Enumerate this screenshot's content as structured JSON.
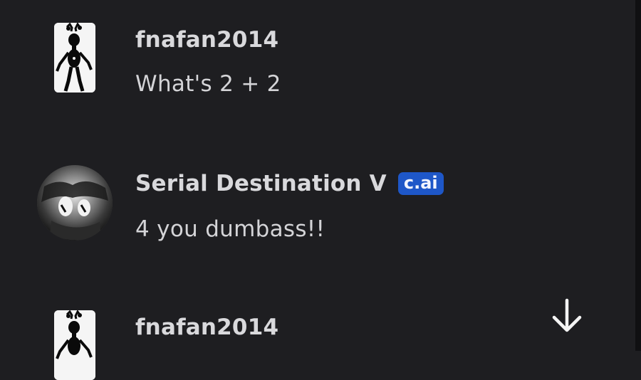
{
  "messages": [
    {
      "author": "fnafan2014",
      "text": "What's 2 + 2",
      "avatar_icon": "animatronic-avatar-icon"
    },
    {
      "author": "Serial Destination V",
      "badge": "c.ai",
      "text": "4 you dumbass!!",
      "avatar_icon": "character-avatar-icon"
    },
    {
      "author": "fnafan2014",
      "text": "",
      "avatar_icon": "animatronic-avatar-icon"
    }
  ],
  "scroll_button": {
    "icon": "arrow-down-icon"
  },
  "colors": {
    "background": "#1e1e21",
    "badge": "#1e57c8",
    "author_text": "#d9d9dc",
    "message_text": "#d4d4d7"
  }
}
